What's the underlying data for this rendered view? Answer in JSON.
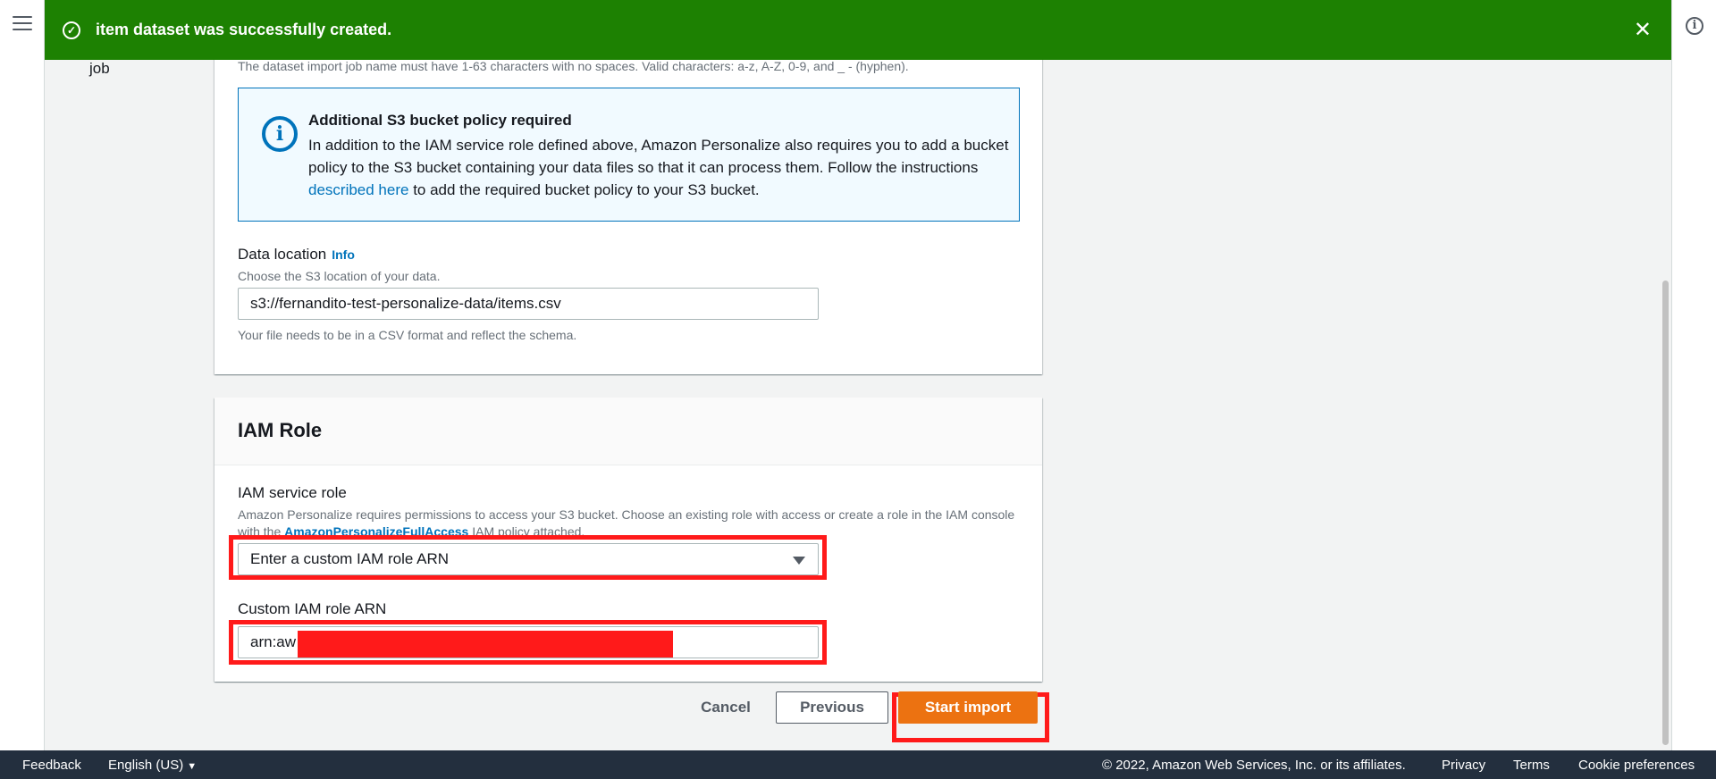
{
  "flash": {
    "message": "item dataset was successfully created."
  },
  "side_label": "job",
  "dataset_job": {
    "name_constraint": "The dataset import job name must have 1-63 characters with no spaces. Valid characters: a-z, A-Z, 0-9, and _ - (hyphen)."
  },
  "alert": {
    "title": "Additional S3 bucket policy required",
    "body_before_link": "In addition to the IAM service role defined above, Amazon Personalize also requires you to add a bucket policy to the S3 bucket containing your data files so that it can process them. Follow the instructions ",
    "link_text": "described here",
    "body_after_link": " to add the required bucket policy to your S3 bucket."
  },
  "data_location": {
    "label": "Data location",
    "info": "Info",
    "description": "Choose the S3 location of your data.",
    "value": "s3://fernandito-test-personalize-data/items.csv",
    "constraint": "Your file needs to be in a CSV format and reflect the schema."
  },
  "iam_role": {
    "header": "IAM Role",
    "service_role_label": "IAM service role",
    "service_role_desc_before": "Amazon Personalize requires permissions to access your S3 bucket. Choose an existing role with access or create a role in the IAM console with the ",
    "service_role_desc_link": "AmazonPersonalizeFullAccess",
    "service_role_desc_after": " IAM policy attached.",
    "select_value": "Enter a custom IAM role ARN",
    "custom_arn_label": "Custom IAM role ARN",
    "custom_arn_value": "arn:aw"
  },
  "actions": {
    "cancel": "Cancel",
    "previous": "Previous",
    "start_import": "Start import"
  },
  "footer": {
    "feedback": "Feedback",
    "language": "English (US)",
    "copyright": "© 2022, Amazon Web Services, Inc. or its affiliates.",
    "privacy": "Privacy",
    "terms": "Terms",
    "cookie": "Cookie preferences"
  },
  "colors": {
    "success": "#1d8102",
    "primary_button": "#ec7211",
    "link": "#0073bb",
    "highlight": "#ff1a1a",
    "footer_bg": "#232f3e"
  },
  "icons": [
    "menu-icon",
    "success-check-icon",
    "close-icon",
    "info-icon",
    "help-info-icon",
    "caret-down-icon"
  ]
}
